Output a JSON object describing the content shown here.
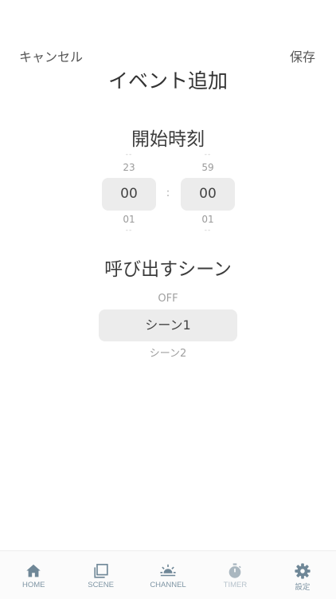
{
  "header": {
    "cancel_label": "キャンセル",
    "save_label": "保存",
    "title": "イベント追加"
  },
  "start_time": {
    "title": "開始時刻",
    "hour": {
      "far_above": "--",
      "above": "23",
      "selected": "00",
      "below": "01",
      "far_below": "--"
    },
    "separator": ":",
    "minute": {
      "far_above": "--",
      "above": "59",
      "selected": "00",
      "below": "01",
      "far_below": "--"
    }
  },
  "scene": {
    "title": "呼び出すシーン",
    "above": "OFF",
    "selected": "シーン1",
    "below": "シーン2"
  },
  "tabbar": {
    "items": [
      {
        "label": "HOME",
        "icon": "home-icon"
      },
      {
        "label": "SCENE",
        "icon": "scene-icon"
      },
      {
        "label": "CHANNEL",
        "icon": "sun-icon"
      },
      {
        "label": "TIMER",
        "icon": "stopwatch-icon"
      },
      {
        "label": "設定",
        "icon": "gear-icon"
      }
    ]
  },
  "colors": {
    "tab_active": "#7f95a4",
    "tab_dim": "#b7c3cc",
    "selection_bg": "#ececec"
  }
}
